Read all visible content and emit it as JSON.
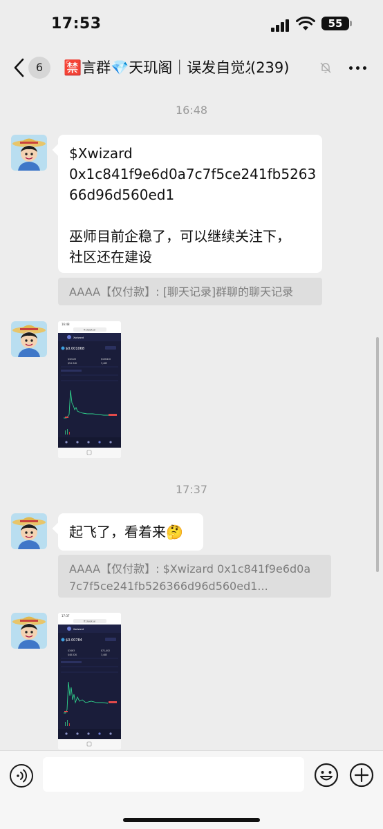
{
  "status_bar": {
    "time": "17:53",
    "battery": "55"
  },
  "nav": {
    "unread_count": "6",
    "title": "🈲言群💎天玑阁｜误发自觉发红包",
    "member_count": "(239)"
  },
  "messages": {
    "time1": "16:48",
    "msg1_lines": [
      "$Xwizard",
      "0x1c841f9e6d0a7c7f5ce241fb5263",
      "66d96d560ed1",
      "",
      "巫师目前企稳了，可以继续关注下，",
      "社区还在建设"
    ],
    "quote1": "AAAA【仅付款】: [聊天记录]群聊的聊天记录",
    "time2": "17:37",
    "msg2": "起飞了，看着来🤔",
    "quote2_line1": "AAAA【仅付款】: $Xwizard 0x1c841f9e6d0a",
    "quote2_line2": "7c7f5ce241fb526366d96d560ed1..."
  },
  "screenshot1": {
    "time": "16:48",
    "url": "ff.dexjk.ai",
    "token": "Xwizard",
    "price": "$0.001068",
    "stat_a": "$32425",
    "stat_b": "$54.34K",
    "stat_c": "$106410",
    "stat_d": "3,483"
  },
  "screenshot2": {
    "time": "17:37",
    "url": "ff.dexjk.ai",
    "token": "Xwizard",
    "price": "$0.00784",
    "stat_a": "$3463",
    "stat_b": "$48.52K",
    "stat_c": "$71,402",
    "stat_d": "3,483"
  },
  "input": {
    "placeholder": ""
  },
  "colors": {
    "background": "#ededed",
    "bubble": "#ffffff",
    "quote": "#dedede",
    "muted": "#9a9a9a"
  }
}
